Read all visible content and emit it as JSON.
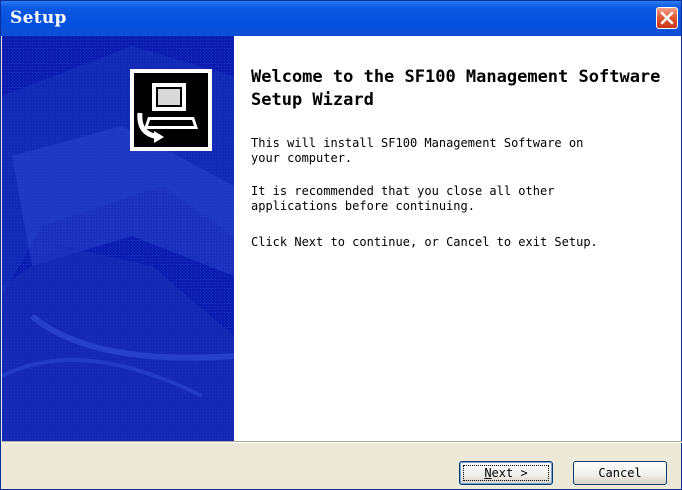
{
  "window": {
    "title": "Setup"
  },
  "icons": {
    "close": "close-icon",
    "app": "setup-computer-icon"
  },
  "content": {
    "heading": "Welcome to the SF100 Management Software Setup Wizard",
    "paragraph1": "This will install SF100 Management Software on\nyour computer.",
    "paragraph2": "It is recommended that you close all other\napplications before continuing.",
    "paragraph3": "Click Next to continue, or Cancel to exit Setup."
  },
  "buttons": {
    "next_accel": "N",
    "next_rest": "ext >",
    "cancel": "Cancel"
  },
  "colors": {
    "titlebar": "#0550dc",
    "side_panel": "#0a1aa8",
    "close": "#e0542e"
  }
}
